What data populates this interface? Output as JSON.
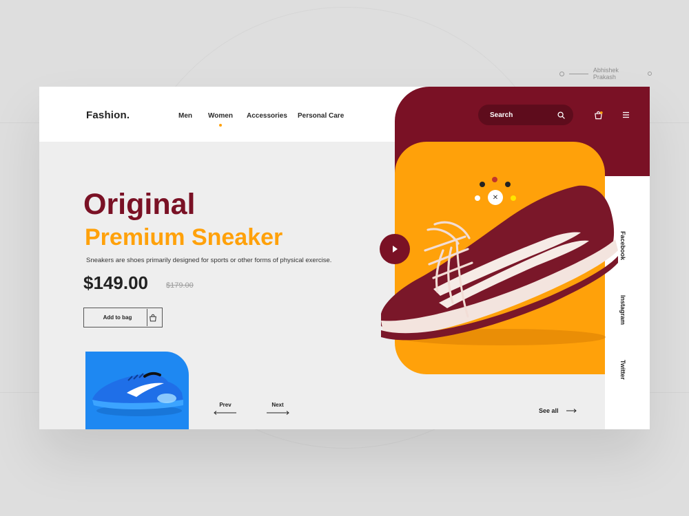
{
  "credit": {
    "author": "Abhishek Prakash"
  },
  "header": {
    "logo": "Fashion.",
    "nav": [
      {
        "label": "Men",
        "active": false
      },
      {
        "label": "Women",
        "active": true
      },
      {
        "label": "Accessories",
        "active": false
      },
      {
        "label": "Personal Care",
        "active": false
      }
    ],
    "search": {
      "placeholder": "Search"
    },
    "icons": [
      "search-icon",
      "shopping-bag-icon",
      "menu-icon"
    ]
  },
  "hero": {
    "title": "Original",
    "subtitle": "Premium Sneaker",
    "description": "Sneakers are shoes primarily designed for sports or other forms of physical exercise.",
    "price": "$149.00",
    "old_price": "$179.00",
    "add_to_bag_label": "Add to bag"
  },
  "product": {
    "color_swatches": [
      "#222222",
      "#c0362c",
      "#222222",
      "#ffffff",
      "#ffe600"
    ]
  },
  "pager": {
    "prev_label": "Prev",
    "next_label": "Next",
    "see_all_label": "See all"
  },
  "social": [
    "Facebook",
    "Instagram",
    "Twitter"
  ],
  "colors": {
    "maroon": "#7a1125",
    "orange": "#ffa10a",
    "blue": "#1e88f2",
    "background": "#eeeeee"
  }
}
